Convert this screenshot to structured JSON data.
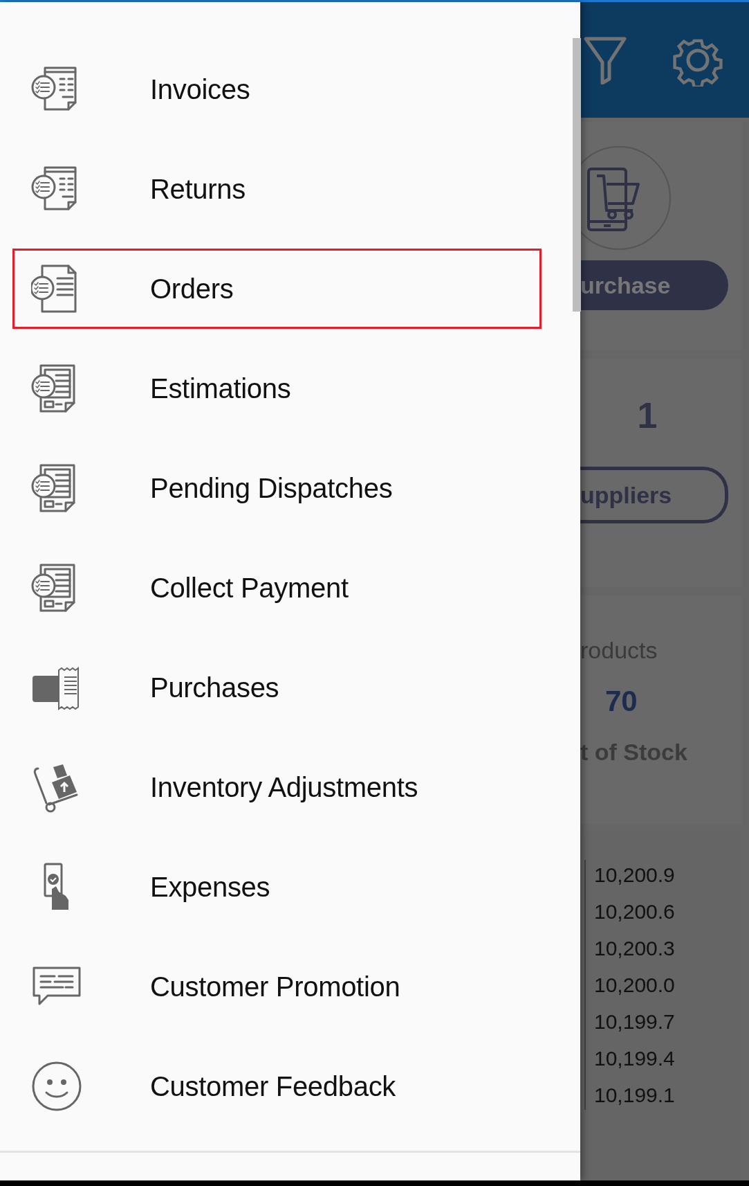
{
  "drawer": {
    "items": [
      {
        "label": "Invoices",
        "kind": "checklist",
        "selected": false
      },
      {
        "label": "Returns",
        "kind": "checklist",
        "selected": false
      },
      {
        "label": "Orders",
        "kind": "folded",
        "selected": true
      },
      {
        "label": "Estimations",
        "kind": "form",
        "selected": false
      },
      {
        "label": "Pending Dispatches",
        "kind": "form",
        "selected": false
      },
      {
        "label": "Collect Payment",
        "kind": "form",
        "selected": false
      },
      {
        "label": "Purchases",
        "kind": "receipt",
        "selected": false
      },
      {
        "label": "Inventory Adjustments",
        "kind": "truck",
        "selected": false
      },
      {
        "label": "Expenses",
        "kind": "cash",
        "selected": false
      },
      {
        "label": "Customer Promotion",
        "kind": "chat",
        "selected": false
      },
      {
        "label": "Customer Feedback",
        "kind": "smiley",
        "selected": false
      }
    ]
  },
  "background": {
    "purchase_button": "urchase",
    "suppliers_count": "1",
    "suppliers_button": "uppliers",
    "products_label": "roducts",
    "products_count": "70",
    "stock_label": "t of Stock",
    "axis_labels": [
      "10,200.9",
      "10,200.6",
      "10,200.3",
      "10,200.0",
      "10,199.7",
      "10,199.4",
      "10,199.1"
    ]
  }
}
